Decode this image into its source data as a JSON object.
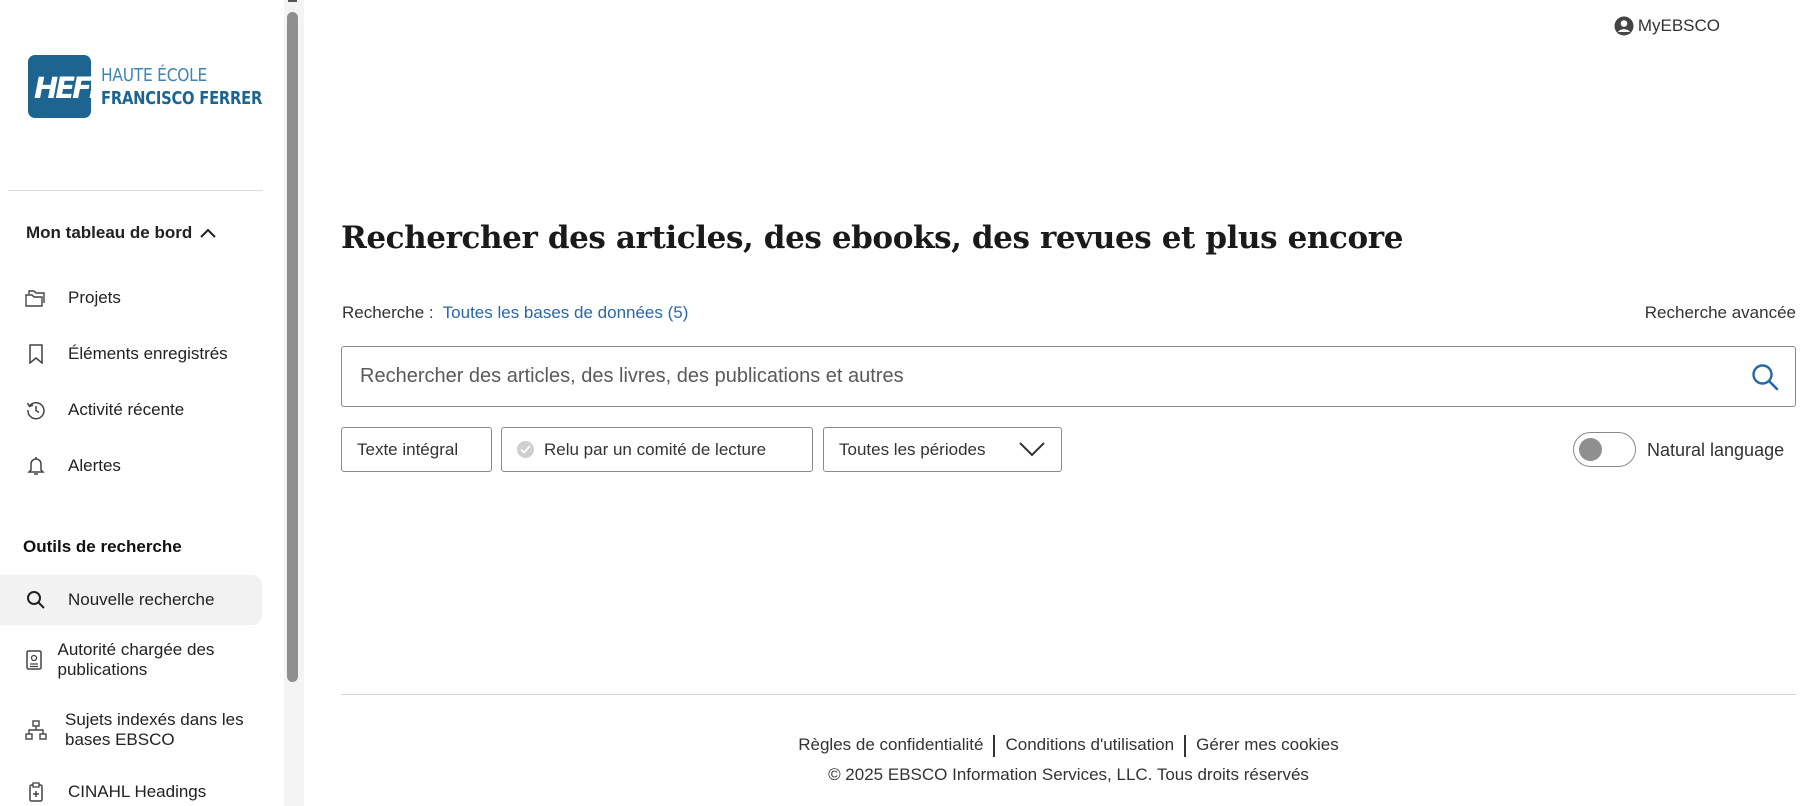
{
  "header": {
    "account_label": "MyEBSCO"
  },
  "logo": {
    "mark_text": "HEFF",
    "line1": "HAUTE ÉCOLE",
    "line2": "FRANCISCO FERRER"
  },
  "sidebar": {
    "dashboard_label": "Mon tableau de bord",
    "items": [
      {
        "label": "Projets",
        "icon": "folder-icon"
      },
      {
        "label": "Éléments enregistrés",
        "icon": "bookmark-icon"
      },
      {
        "label": "Activité récente",
        "icon": "history-icon"
      },
      {
        "label": "Alertes",
        "icon": "bell-icon"
      }
    ],
    "tools_label": "Outils de recherche",
    "tools": [
      {
        "label": "Nouvelle recherche",
        "icon": "search-icon",
        "active": true
      },
      {
        "label": "Autorité chargée des publications",
        "icon": "publication-icon"
      },
      {
        "label": "Sujets indexés dans les bases EBSCO",
        "icon": "hierarchy-icon"
      },
      {
        "label": "CINAHL Headings",
        "icon": "clipboard-icon"
      }
    ]
  },
  "main": {
    "title": "Rechercher des articles, des ebooks, des revues et plus encore",
    "scope_label": "Recherche :",
    "scope_value": "Toutes les bases de données (5)",
    "advanced_search": "Recherche avancée",
    "search_placeholder": "Rechercher des articles, des livres, des publications et autres",
    "filters": {
      "full_text": "Texte intégral",
      "peer_reviewed": "Relu par un comité de lecture",
      "period": "Toutes les périodes"
    },
    "natural_language_label": "Natural language",
    "natural_language_on": false
  },
  "footer": {
    "links": [
      "Règles de confidentialité",
      "Conditions d'utilisation",
      "Gérer mes cookies"
    ],
    "copyright": "© 2025 EBSCO Information Services, LLC. Tous droits réservés"
  },
  "colors": {
    "brand": "#1d6491",
    "link": "#2a67a8"
  }
}
